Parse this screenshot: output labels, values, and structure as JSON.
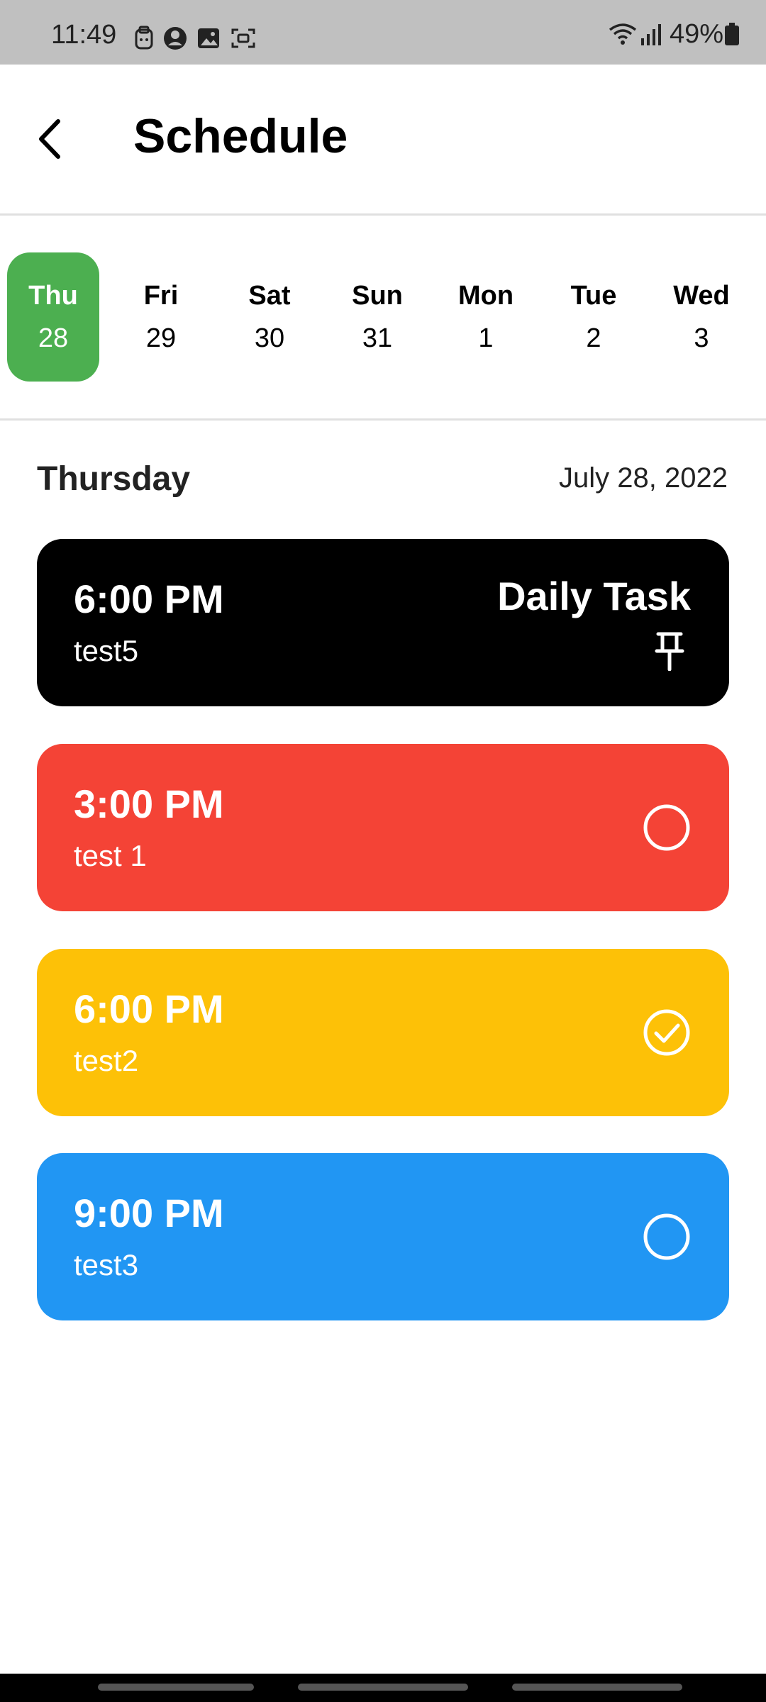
{
  "status_bar": {
    "time": "11:49",
    "battery": "49%",
    "icons": [
      "clipboard-icon",
      "account-icon",
      "gallery-icon",
      "screen-capture-icon",
      "wifi-icon",
      "signal-icon",
      "battery-icon"
    ]
  },
  "header": {
    "title": "Schedule",
    "back_icon": "back-arrow-icon"
  },
  "days": [
    {
      "name": "Thu",
      "num": "28",
      "selected": true
    },
    {
      "name": "Fri",
      "num": "29"
    },
    {
      "name": "Sat",
      "num": "30"
    },
    {
      "name": "Sun",
      "num": "31"
    },
    {
      "name": "Mon",
      "num": "1"
    },
    {
      "name": "Tue",
      "num": "2"
    },
    {
      "name": "Wed",
      "num": "3"
    }
  ],
  "selected_day": {
    "name": "Thursday",
    "date": "July 28, 2022"
  },
  "tasks": [
    {
      "time": "6:00 PM",
      "name": "test5",
      "tag": "Daily Task",
      "color": "#000000",
      "status": "pinned"
    },
    {
      "time": "3:00 PM",
      "name": "test 1",
      "color": "#f44336",
      "status": "incomplete"
    },
    {
      "time": "6:00 PM",
      "name": "test2",
      "color": "#fdc107",
      "status": "completed"
    },
    {
      "time": "9:00 PM",
      "name": "test3",
      "color": "#2196f3",
      "status": "incomplete"
    }
  ],
  "colors": {
    "accent": "#4caf50",
    "status_bar": "#c0c0c0",
    "divider": "#e0e0e0"
  }
}
